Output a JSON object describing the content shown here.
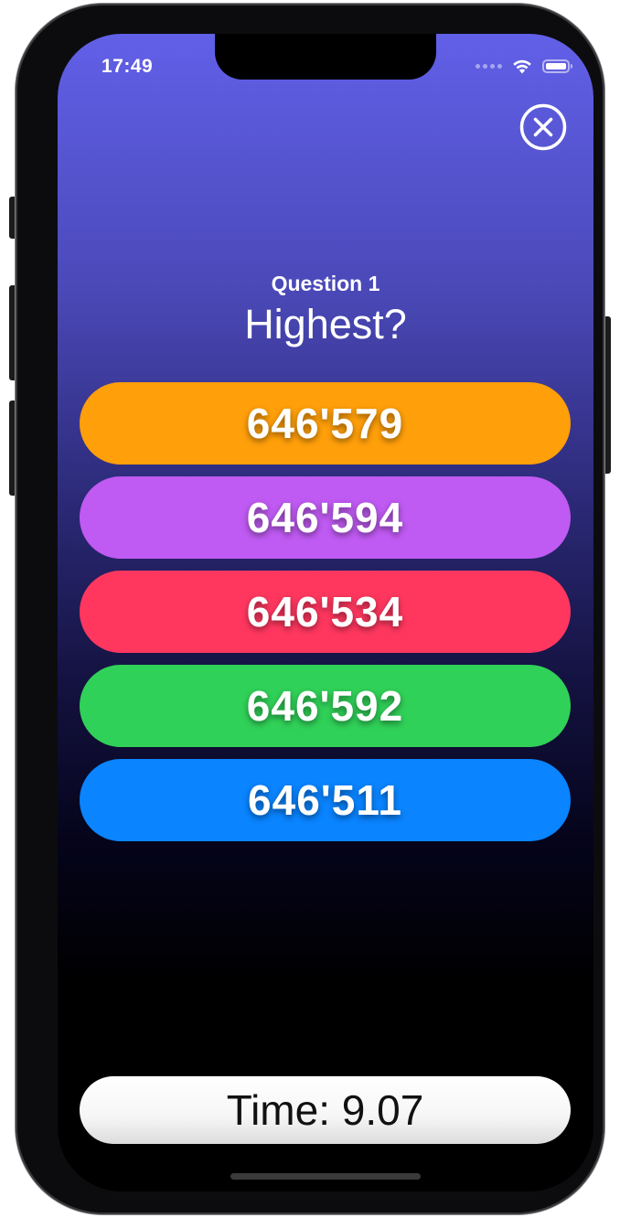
{
  "status_bar": {
    "time": "17:49",
    "icons": [
      "cellular-signal-icon",
      "wifi-icon",
      "battery-icon"
    ]
  },
  "header": {
    "close_icon": "close-circle-icon"
  },
  "question": {
    "number_label": "Question 1",
    "text": "Highest?"
  },
  "answers": [
    {
      "label": "646'579",
      "color": "#FF9F0A"
    },
    {
      "label": "646'594",
      "color": "#BF5AF2"
    },
    {
      "label": "646'534",
      "color": "#FF375F"
    },
    {
      "label": "646'592",
      "color": "#30D158"
    },
    {
      "label": "646'511",
      "color": "#0A84FF"
    }
  ],
  "timer": {
    "label": "Time: 9.07"
  },
  "colors": {
    "background_top": "#6160E8",
    "background_bottom": "#000000"
  }
}
